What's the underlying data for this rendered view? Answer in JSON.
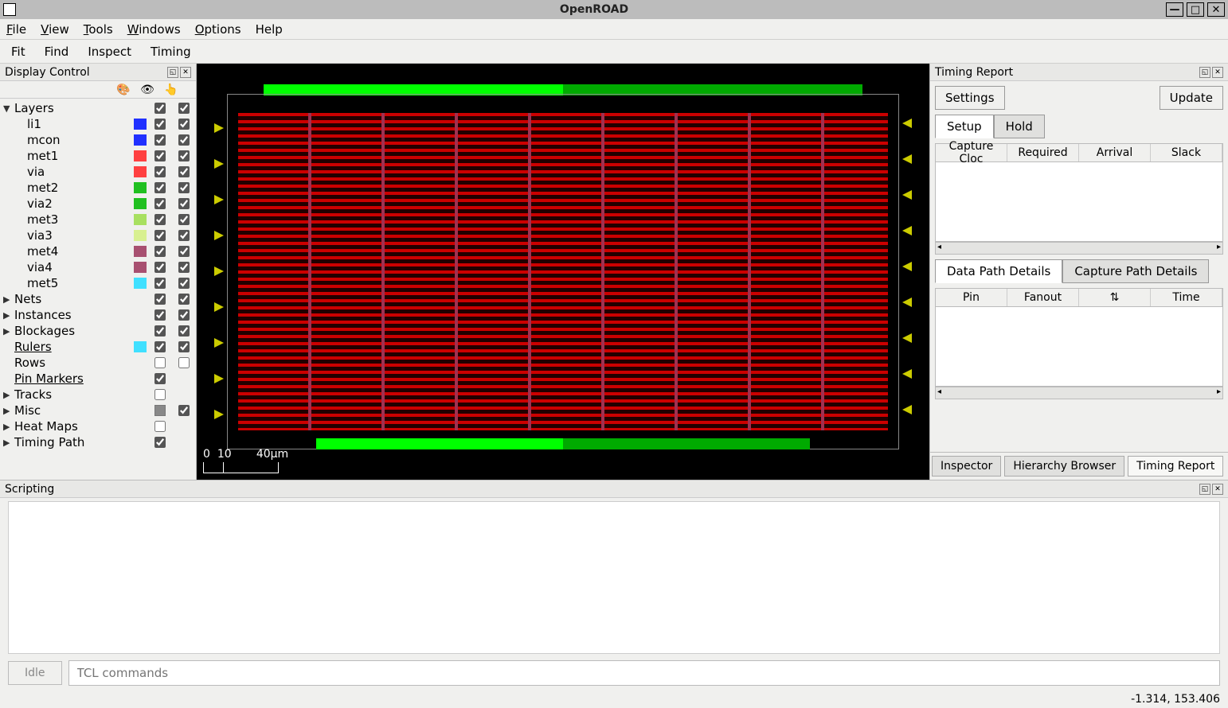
{
  "window": {
    "title": "OpenROAD"
  },
  "menubar": {
    "file": "File",
    "view": "View",
    "tools": "Tools",
    "windows": "Windows",
    "options": "Options",
    "help": "Help"
  },
  "toolbar": {
    "fit": "Fit",
    "find": "Find",
    "inspect": "Inspect",
    "timing": "Timing"
  },
  "display_control": {
    "title": "Display Control",
    "header_icons": {
      "color": "🎨",
      "visible": "👁",
      "select": "👆"
    },
    "groups": [
      {
        "label": "Layers",
        "expanded": true,
        "vis": true,
        "sel": true,
        "children": [
          {
            "label": "li1",
            "color": "#2030ff",
            "vis": true,
            "sel": true
          },
          {
            "label": "mcon",
            "color": "#2030ff",
            "vis": true,
            "sel": true
          },
          {
            "label": "met1",
            "color": "#ff4040",
            "vis": true,
            "sel": true
          },
          {
            "label": "via",
            "color": "#ff4040",
            "vis": true,
            "sel": true
          },
          {
            "label": "met2",
            "color": "#20c020",
            "vis": true,
            "sel": true
          },
          {
            "label": "via2",
            "color": "#20c020",
            "vis": true,
            "sel": true
          },
          {
            "label": "met3",
            "color": "#a8e060",
            "vis": true,
            "sel": true
          },
          {
            "label": "via3",
            "color": "#d8f090",
            "vis": true,
            "sel": true
          },
          {
            "label": "met4",
            "color": "#a85070",
            "vis": true,
            "sel": true
          },
          {
            "label": "via4",
            "color": "#a85070",
            "vis": true,
            "sel": true
          },
          {
            "label": "met5",
            "color": "#40e0ff",
            "vis": true,
            "sel": true
          }
        ]
      },
      {
        "label": "Nets",
        "expanded": false,
        "vis": true,
        "sel": true
      },
      {
        "label": "Instances",
        "expanded": false,
        "vis": true,
        "sel": true
      },
      {
        "label": "Blockages",
        "expanded": false,
        "vis": true,
        "sel": true
      },
      {
        "label": "Rulers",
        "underline": true,
        "color": "#40e0ff",
        "vis": true,
        "sel": true
      },
      {
        "label": "Rows",
        "vis": false,
        "sel": false
      },
      {
        "label": "Pin Markers",
        "underline": true,
        "vis": true
      },
      {
        "label": "Tracks",
        "expanded": false,
        "vis": false
      },
      {
        "label": "Misc",
        "expanded": false,
        "vis": "mixed",
        "sel": true
      },
      {
        "label": "Heat Maps",
        "expanded": false,
        "vis": false
      },
      {
        "label": "Timing Path",
        "expanded": false,
        "vis": true
      }
    ]
  },
  "canvas": {
    "scale_labels": {
      "zero": "0",
      "ten": "10",
      "label": "40µm"
    }
  },
  "timing_report": {
    "title": "Timing Report",
    "settings": "Settings",
    "update": "Update",
    "tabs": {
      "setup": "Setup",
      "hold": "Hold"
    },
    "columns1": [
      "Capture Cloc",
      "Required",
      "Arrival",
      "Slack"
    ],
    "tabs2": {
      "data": "Data Path Details",
      "capture": "Capture Path Details"
    },
    "columns2": [
      "Pin",
      "Fanout",
      "⇅",
      "Time"
    ],
    "bottom_tabs": {
      "inspector": "Inspector",
      "hierarchy": "Hierarchy Browser",
      "timing": "Timing Report"
    }
  },
  "scripting": {
    "title": "Scripting",
    "idle": "Idle",
    "placeholder": "TCL commands"
  },
  "status": {
    "coords": "-1.314, 153.406"
  }
}
